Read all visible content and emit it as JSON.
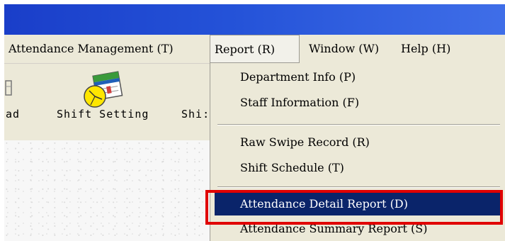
{
  "menubar": {
    "items": [
      {
        "label": "Attendance Management (T)"
      },
      {
        "label": "Report (R)"
      },
      {
        "label": "Window (W)"
      },
      {
        "label": "Help (H)"
      }
    ]
  },
  "toolbar": {
    "left_partial_label": "ad",
    "shift_setting_label": "Shift Setting",
    "right_partial_label": "Shi:"
  },
  "report_menu": {
    "items": [
      {
        "label": "Department Info (P)"
      },
      {
        "label": "Staff Information (F)"
      },
      {
        "label": "Raw Swipe Record (R)"
      },
      {
        "label": "Shift Schedule (T)"
      },
      {
        "label": "Attendance Detail Report (D)",
        "highlighted": true
      },
      {
        "label": "Attendance Summary Report (S)"
      }
    ]
  },
  "colors": {
    "title_bar": "#2452d8",
    "highlight": "#0a246a",
    "annotation": "#e00000"
  }
}
